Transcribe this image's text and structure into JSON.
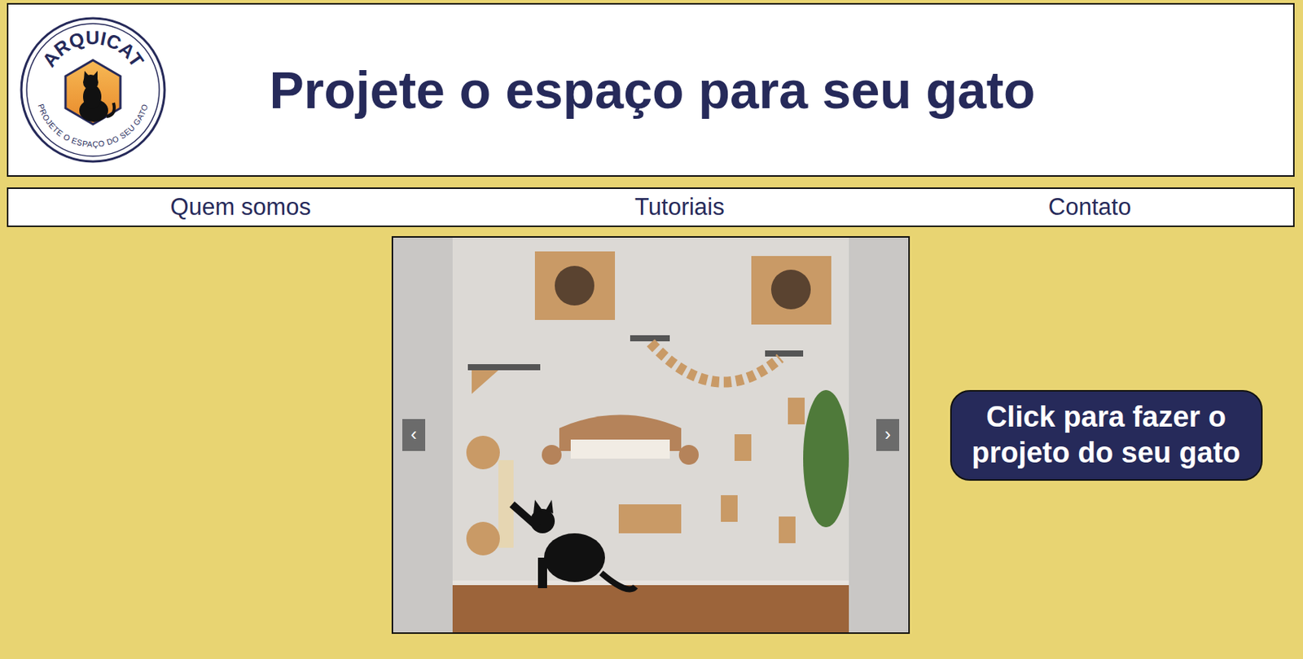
{
  "logo": {
    "brand": "ARQUICAT",
    "tagline": "PROJETE O ESPAÇO DO SEU GATO"
  },
  "header": {
    "title": "Projete o espaço para seu gato"
  },
  "nav": {
    "items": [
      {
        "label": "Quem somos"
      },
      {
        "label": "Tutoriais"
      },
      {
        "label": "Contato"
      }
    ]
  },
  "carousel": {
    "prev": "‹",
    "next": "›"
  },
  "cta": {
    "label": "Click para fazer o projeto do seu gato"
  }
}
